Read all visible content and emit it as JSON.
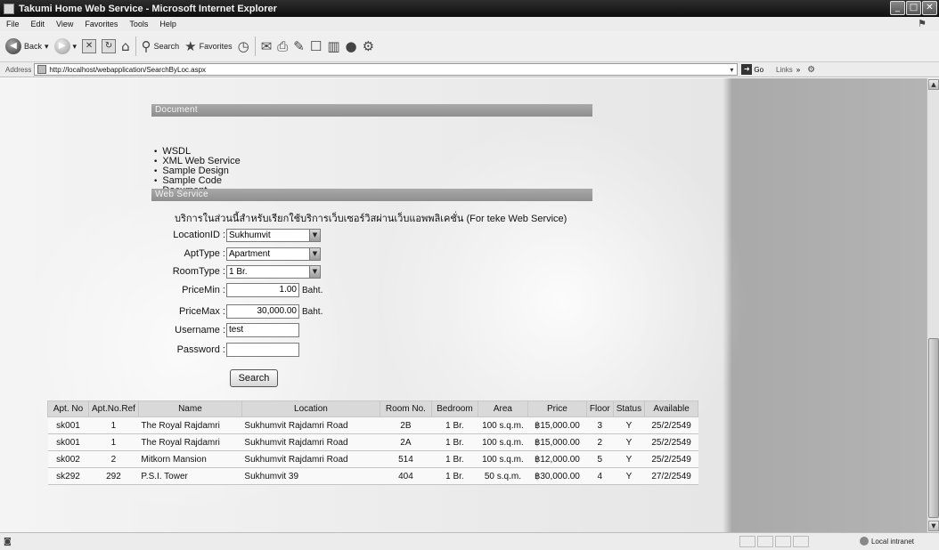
{
  "window": {
    "title": "Takumi Home Web Service - Microsoft Internet Explorer"
  },
  "menu": [
    "File",
    "Edit",
    "View",
    "Favorites",
    "Tools",
    "Help"
  ],
  "toolbar": {
    "back": "Back",
    "search": "Search",
    "favorites": "Favorites"
  },
  "address": {
    "label": "Address",
    "url": "http://localhost/webapplication/SearchByLoc.aspx",
    "go": "Go",
    "links": "Links"
  },
  "sections": {
    "document": "Document",
    "web_service": "Web Service"
  },
  "doc_links": [
    "WSDL",
    "XML Web Service",
    "Sample Design",
    "Sample Code",
    "Document"
  ],
  "intro_text": "บริการในส่วนนี้สำหรับเรียกใช้บริการเว็บเซอร์วิสผ่านเว็บแอพพลิเคชั่น (For teke Web Service)",
  "form": {
    "location_label": "LocationID :",
    "location_value": "Sukhumvit",
    "apttype_label": "AptType :",
    "apttype_value": "Apartment",
    "roomtype_label": "RoomType :",
    "roomtype_value": "1 Br.",
    "pricemin_label": "PriceMin :",
    "pricemin_value": "1.00",
    "pricemax_label": "PriceMax :",
    "pricemax_value": "30,000.00",
    "unit": "Baht.",
    "username_label": "Username :",
    "username_value": "test",
    "password_label": "Password :",
    "password_value": "",
    "search_label": "Search"
  },
  "table": {
    "headers": [
      "Apt. No",
      "Apt.No.Ref",
      "Name",
      "Location",
      "Room No.",
      "Bedroom",
      "Area",
      "Price",
      "Floor",
      "Status",
      "Available"
    ],
    "rows": [
      [
        "sk001",
        "1",
        "The Royal Rajdamri",
        "Sukhumvit Rajdamri Road",
        "2B",
        "1 Br.",
        "100 s.q.m.",
        "฿15,000.00",
        "3",
        "Y",
        "25/2/2549"
      ],
      [
        "sk001",
        "1",
        "The Royal Rajdamri",
        "Sukhumvit Rajdamri Road",
        "2A",
        "1 Br.",
        "100 s.q.m.",
        "฿15,000.00",
        "2",
        "Y",
        "25/2/2549"
      ],
      [
        "sk002",
        "2",
        "Mitkorn Mansion",
        "Sukhumvit Rajdamri Road",
        "514",
        "1 Br.",
        "100 s.q.m.",
        "฿12,000.00",
        "5",
        "Y",
        "25/2/2549"
      ],
      [
        "sk292",
        "292",
        "P.S.I. Tower",
        "Sukhumvit 39",
        "404",
        "1 Br.",
        "50 s.q.m.",
        "฿30,000.00",
        "4",
        "Y",
        "27/2/2549"
      ]
    ]
  },
  "status": {
    "zone": "Local intranet"
  }
}
